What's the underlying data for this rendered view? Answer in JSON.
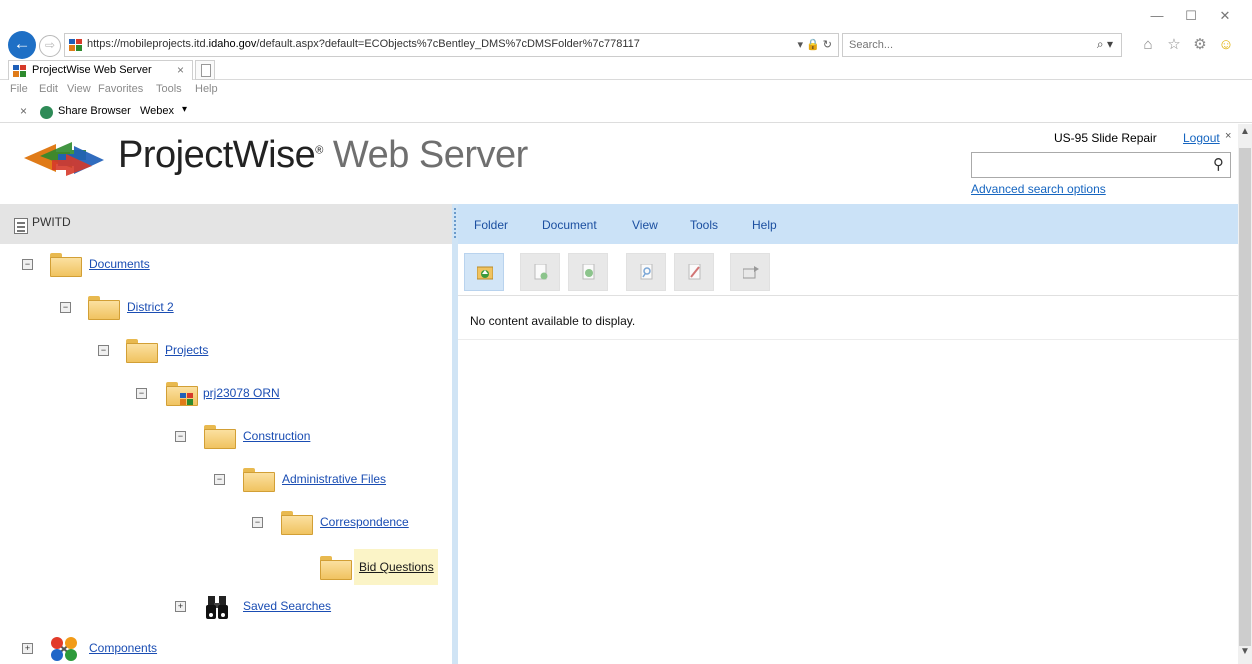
{
  "browser": {
    "url_prefix": "https://mobileprojects.itd.",
    "url_domain": "idaho.gov",
    "url_suffix": "/default.aspx?default=ECObjects%7cBentley_DMS%7cDMSFolder%7c778117",
    "url_controls": "▾ 🔒 ↻",
    "search_placeholder": "Search...",
    "search_icon": "⌕ ▾",
    "tab_title": "ProjectWise Web Server",
    "tab_close": "×",
    "menu": [
      "File",
      "Edit",
      "View",
      "Favorites",
      "Tools",
      "Help"
    ],
    "fav_close": "×",
    "fav_share": "Share Browser",
    "fav_webex": "Webex",
    "fav_webex_arrow": "▾",
    "window_min": "—",
    "window_max": "☐",
    "window_close": "✕"
  },
  "header": {
    "brand_main": "ProjectWise",
    "brand_reg": "®",
    "brand_light": " Web Server",
    "project_name": "US-95 Slide Repair",
    "logout": "Logout",
    "logout_x": "×",
    "search_icon": "⚲",
    "advanced_search": "Advanced search options"
  },
  "left_panel": {
    "datasource": "PWITD",
    "tree": [
      {
        "label": "Documents",
        "toggle": "−"
      },
      {
        "label": "District 2",
        "toggle": "−"
      },
      {
        "label": "Projects",
        "toggle": "−"
      },
      {
        "label": "prj23078 ORN",
        "toggle": "−"
      },
      {
        "label": "Construction",
        "toggle": "−"
      },
      {
        "label": "Administrative Files",
        "toggle": "−"
      },
      {
        "label": "Correspondence",
        "toggle": "−"
      },
      {
        "label": "Bid Questions",
        "toggle": ""
      },
      {
        "label": "Saved Searches",
        "toggle": "+"
      },
      {
        "label": "Components",
        "toggle": "+"
      }
    ]
  },
  "right_panel": {
    "menu": [
      "Folder",
      "Document",
      "View",
      "Tools",
      "Help"
    ],
    "empty_message": "No content available to display."
  },
  "scrollbar": {
    "up": "▲",
    "down": "▼"
  },
  "colors": {
    "accent_blue": "#1565c0",
    "menu_bar": "#cbe2f7",
    "selection": "#fbf4c7"
  }
}
